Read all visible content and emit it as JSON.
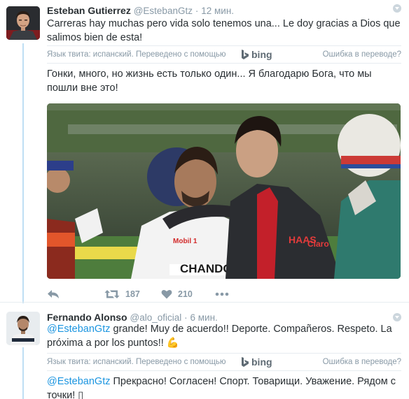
{
  "tweets": [
    {
      "fullname": "Esteban Gutierrez",
      "handle": "@EstebanGtz",
      "separator": "·",
      "time": "12 мин.",
      "text": "Carreras hay muchas pero vida solo tenemos una... Le doy gracias a Dios que salimos bien de esta!",
      "translated_label": "Язык твита: испанский. Переведено с помощью",
      "translator": "bing",
      "error_link": "Ошибка в переводе?",
      "translation": "Гонки, много, но жизнь есть только один... Я благодарю Бога, что мы пошли вне это!",
      "media_text": [
        "CHANDON",
        "Claro",
        "HAAS",
        "Mobil 1"
      ],
      "actions": {
        "retweets": "187",
        "likes": "210"
      }
    },
    {
      "fullname": "Fernando Alonso",
      "handle": "@alo_oficial",
      "separator": "·",
      "time": "6 мин.",
      "mention": "@EstebanGtz",
      "text": " grande! Muy de acuerdo!! Deporte. Compañeros. Respeto. La próxima a por los puntos!! 💪",
      "translated_label": "Язык твита: испанский. Переведено с помощью",
      "translator": "bing",
      "error_link": "Ошибка в переводе?",
      "translation_mention": "@EstebanGtz",
      "translation": " Прекрасно! Согласен! Спорт. Товарищи. Уважение. Рядом с точки! ▯"
    }
  ],
  "colors": {
    "link": "#1b95e0",
    "muted": "#8899a6",
    "thread": "#bfdff4",
    "text": "#292f33"
  },
  "icons": [
    "reply-icon",
    "retweet-icon",
    "heart-icon",
    "more-icon",
    "caret-icon",
    "bing-logo-icon"
  ]
}
